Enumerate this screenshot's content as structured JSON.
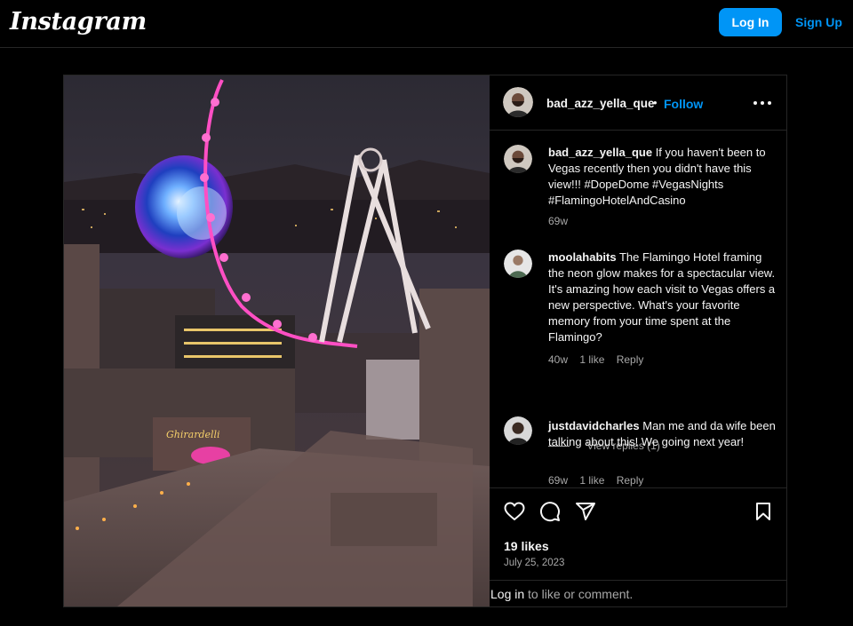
{
  "header": {
    "logo_text": "Instagram",
    "login_label": "Log In",
    "signup_label": "Sign Up"
  },
  "post": {
    "author": "bad_azz_yella_que",
    "dot": "•",
    "follow_label": "Follow",
    "more_icon": "more-horizontal-icon",
    "caption": {
      "user": "bad_azz_yella_que",
      "text": "If you haven't been to Vegas recently then you didn't have this view!!! #DopeDome #VegasNights #FlamingoHotelAndCasino",
      "time": "69w"
    },
    "comments": [
      {
        "user": "moolahabits",
        "text": "The Flamingo Hotel framing the neon glow makes for a spectacular view. It's amazing how each visit to Vegas offers a new perspective. What's your favorite memory from your time spent at the Flamingo?",
        "time": "40w",
        "likes": "1 like",
        "reply_label": "Reply"
      },
      {
        "user": "justdavidcharles",
        "text": "Man me and da wife been talking about this! We going next year!",
        "time": "69w",
        "likes": "1 like",
        "reply_label": "Reply"
      }
    ],
    "view_replies_label": "View replies (1)",
    "likes_count": "19 likes",
    "date": "July 25, 2023",
    "footer": {
      "login_link": "Log in",
      "rest": "to like or comment."
    }
  },
  "icons": [
    "heart-icon",
    "comment-icon",
    "share-icon",
    "bookmark-icon"
  ],
  "colors": {
    "accent": "#0095f6",
    "background": "#000000",
    "secondary_text": "#a8a8a8",
    "border": "#262626"
  }
}
